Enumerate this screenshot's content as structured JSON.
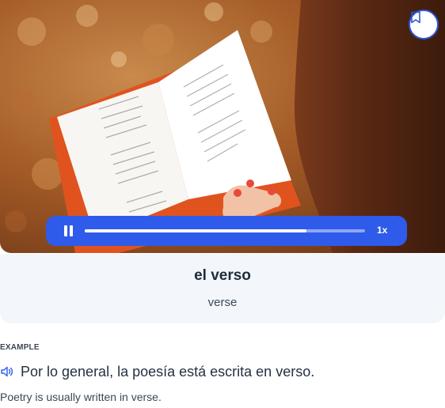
{
  "audio": {
    "speed_label": "1x",
    "progress": 0.79
  },
  "word": {
    "term": "el verso",
    "translation": "verse"
  },
  "example": {
    "label": "EXAMPLE",
    "sentence": "Por lo general, la poesía está escrita en verso.",
    "translation": "Poetry is usually written in verse."
  },
  "icons": {
    "bookmark": "bookmark-icon",
    "pause": "pause-icon",
    "speaker": "speaker-icon"
  },
  "colors": {
    "accent": "#2f5bea",
    "card_bg": "#f3f7fb"
  }
}
